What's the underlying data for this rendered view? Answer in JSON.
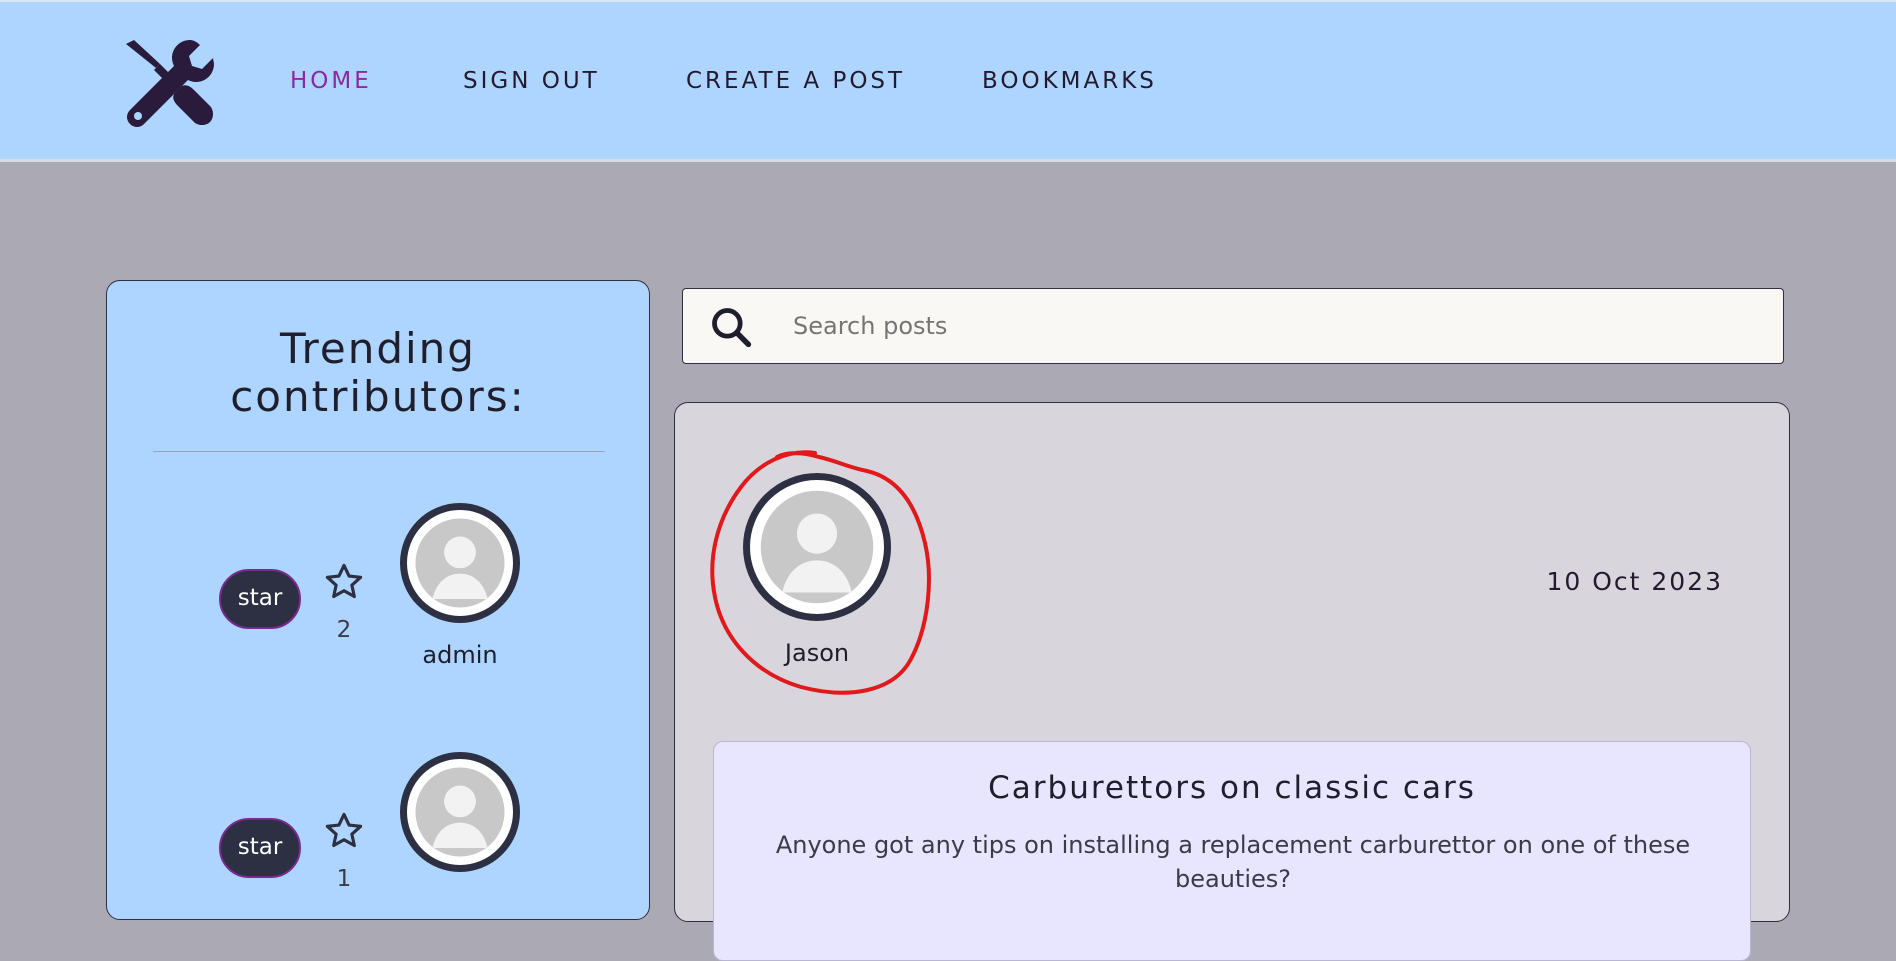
{
  "nav": {
    "links": [
      {
        "label": "HOME",
        "active": true
      },
      {
        "label": "SIGN OUT"
      },
      {
        "label": "CREATE A POST"
      },
      {
        "label": "BOOKMARKS"
      }
    ],
    "logo_icon": "wrench-screwdriver-icon"
  },
  "sidebar": {
    "title_line1": "Trending",
    "title_line2": "contributors:",
    "contributors": [
      {
        "star_label": "star",
        "star_count": "2",
        "name": "admin"
      },
      {
        "star_label": "star",
        "star_count": "1",
        "name": ""
      }
    ]
  },
  "search": {
    "placeholder": "Search posts",
    "icon": "search-icon"
  },
  "post": {
    "author": "Jason",
    "date": "10 Oct 2023",
    "title": "Carburettors on classic cars",
    "body": "Anyone got any tips on installing a replacement carburettor on one of these beauties?"
  },
  "colors": {
    "nav_bg": "#add5ff",
    "page_bg": "#aba9b4",
    "accent_active": "#8a2aa0",
    "dark": "#2d3042",
    "annotation": "#e0191c"
  }
}
